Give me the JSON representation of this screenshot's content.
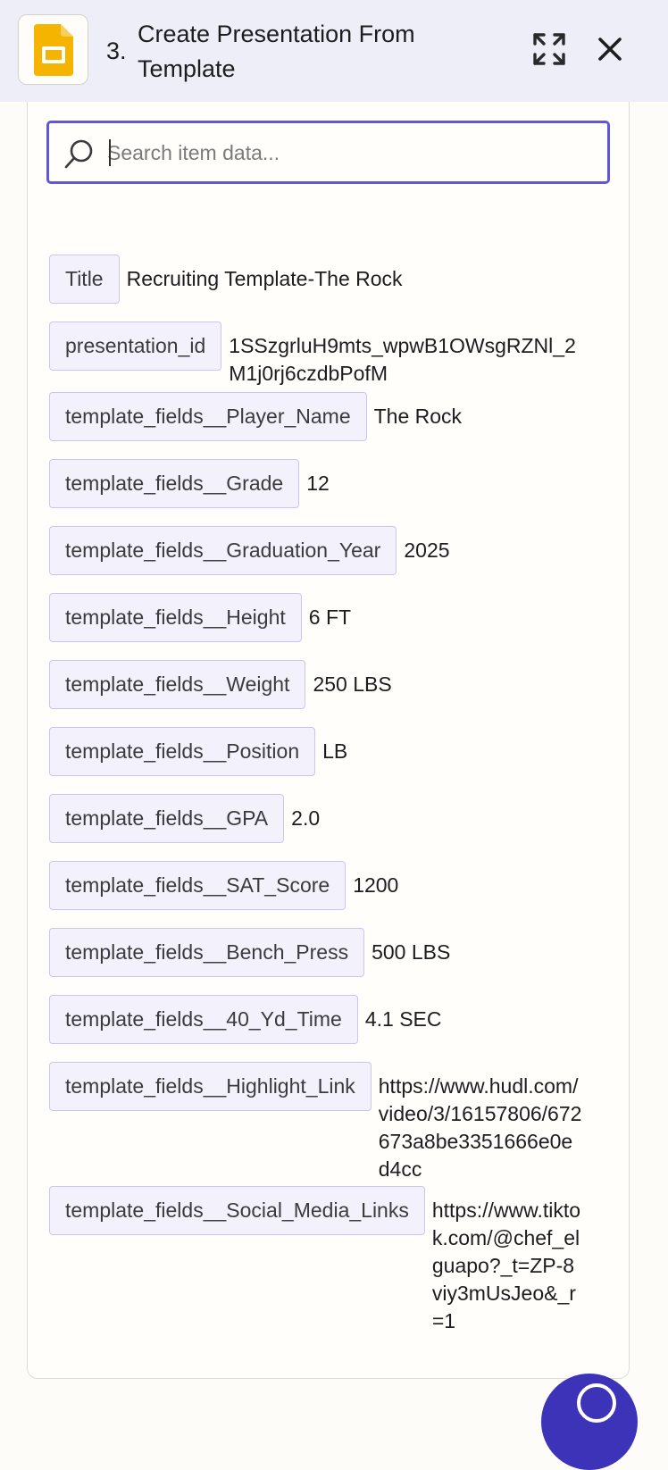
{
  "header": {
    "step_number": "3.",
    "title": "Create Presentation From Template",
    "app_icon": "google-slides-icon",
    "expand_icon": "expand-icon",
    "close_icon": "close-icon"
  },
  "search": {
    "placeholder": "Search item data...",
    "value": ""
  },
  "fields": [
    {
      "key": "Title",
      "value": "Recruiting Template-The Rock"
    },
    {
      "key": "presentation_id",
      "value": "1SSzgrluH9mts_wpwB1OWsgRZNl_2M1j0rj6czdbPofM"
    },
    {
      "key": "template_fields__Player_Name",
      "value": "The Rock"
    },
    {
      "key": "template_fields__Grade",
      "value": "12"
    },
    {
      "key": "template_fields__Graduation_Year",
      "value": "2025"
    },
    {
      "key": "template_fields__Height",
      "value": "6 FT"
    },
    {
      "key": "template_fields__Weight",
      "value": "250 LBS"
    },
    {
      "key": "template_fields__Position",
      "value": "LB"
    },
    {
      "key": "template_fields__GPA",
      "value": "2.0"
    },
    {
      "key": "template_fields__SAT_Score",
      "value": "1200"
    },
    {
      "key": "template_fields__Bench_Press",
      "value": "500 LBS"
    },
    {
      "key": "template_fields__40_Yd_Time",
      "value": "4.1 SEC"
    },
    {
      "key": "template_fields__Highlight_Link",
      "value": "https://www.hudl.com/video/3/16157806/672673a8be3351666e0ed4cc"
    },
    {
      "key": "template_fields__Social_Media_Links",
      "value": "https://www.tiktok.com/@chef_elguapo?_t=ZP-8viy3mUsJeo&_r=1"
    }
  ],
  "colors": {
    "accent": "#6057d6",
    "header_bg": "#eeeef9",
    "key_bg": "#f3f2fc",
    "key_border": "#c9c6f1",
    "slides_yellow": "#f5b400",
    "fab": "#3d33b8"
  }
}
